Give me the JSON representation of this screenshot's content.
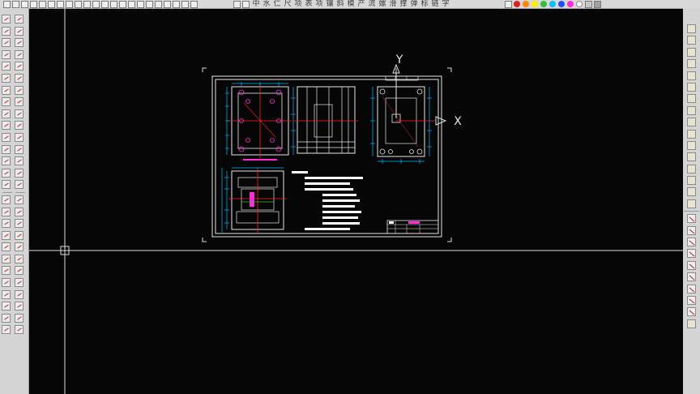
{
  "topbar": {
    "tool_labels": [
      "中",
      "水",
      "仁",
      "尺",
      "项",
      "表",
      "项",
      "镶",
      "斜",
      "模",
      "产",
      "流",
      "嫘",
      "滑",
      "撑",
      "弹",
      "标",
      "链",
      "字"
    ]
  },
  "colors": {
    "canvas_bg": "#060606",
    "drawing_lines": "#ffffff",
    "dimension": "#00b8ff",
    "centerline": "#ff2020",
    "highlight": "#ff2bd6",
    "palette": [
      "#e02020",
      "#ff8800",
      "#ffee00",
      "#30c030",
      "#00c0ff",
      "#2050ff",
      "#ff2bd6",
      "#ffffff",
      "#c8c8c8",
      "#a0a0a0"
    ]
  },
  "icons": {
    "left_toolbar": "cad-draw-tools",
    "right_toolbar": "cad-layer-tools",
    "crosshair": "crosshair-cursor-icon"
  },
  "ucs": {
    "x_label": "X",
    "y_label": "Y"
  }
}
